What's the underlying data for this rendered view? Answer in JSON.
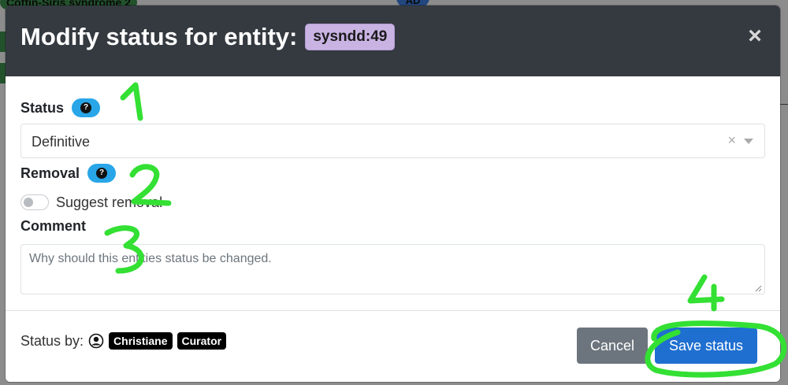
{
  "background": {
    "row1_text": "Coffin-Siris syndrome 2",
    "avatar_text": "AD"
  },
  "modal": {
    "title": "Modify status for entity:",
    "entity_id": "sysndd:49",
    "close_symbol": "×"
  },
  "form": {
    "status_label": "Status",
    "status_value": "Definitive",
    "clear_symbol": "×",
    "removal_label": "Removal",
    "suggest_removal_label": "Suggest removal",
    "suggest_removal_checked": false,
    "comment_label": "Comment",
    "comment_placeholder": "Why should this entities status be changed.",
    "comment_value": ""
  },
  "footer": {
    "status_by_label": "Status by:",
    "user_name": "Christiane",
    "user_role": "Curator",
    "cancel_label": "Cancel",
    "save_label": "Save status"
  },
  "annotations": {
    "color": "#33e033",
    "labels": [
      "1",
      "2",
      "3",
      "4"
    ]
  },
  "colors": {
    "header_bg": "#343a40",
    "entity_badge_bg": "#c9b3e3",
    "help_badge_bg": "#29a6e8",
    "cancel_bg": "#6c757d",
    "save_bg": "#1f6fd1"
  },
  "icons": {
    "help": "question-circle-icon",
    "user": "person-circle-icon",
    "close": "close-icon",
    "caret": "caret-down-icon"
  }
}
